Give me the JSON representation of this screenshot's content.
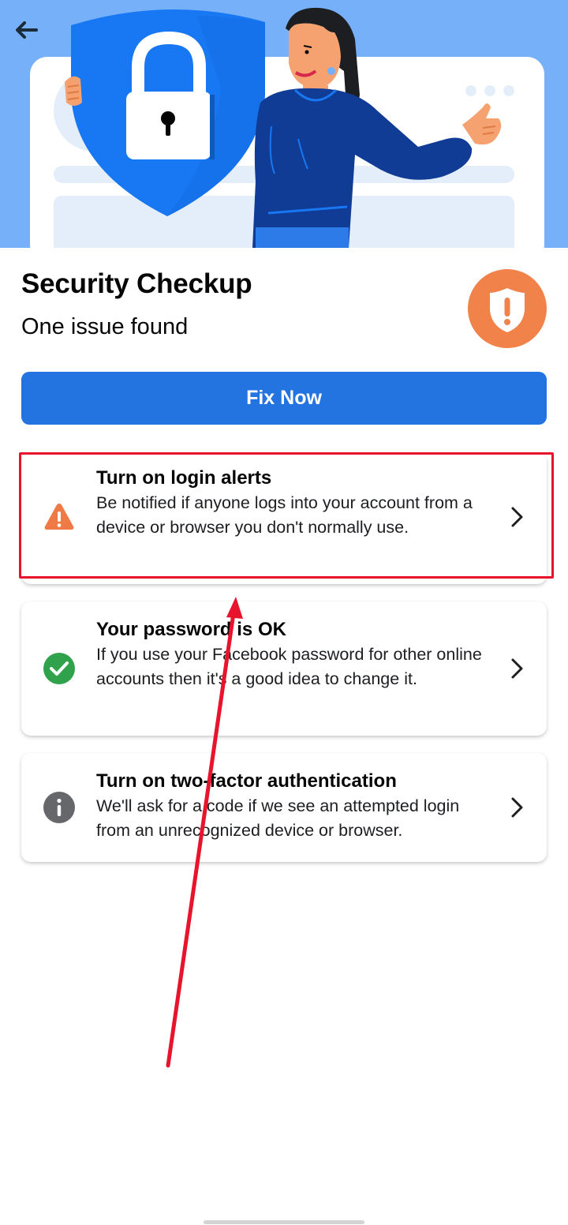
{
  "header": {
    "title": "Security Checkup",
    "subtitle": "One issue found"
  },
  "primary_action": {
    "label": "Fix Now"
  },
  "checks": [
    {
      "title": "Turn on login alerts",
      "description": "Be notified if anyone logs into your account from a device or browser you don't normally use.",
      "status_icon": "warning-icon",
      "status_color": "#f07a45"
    },
    {
      "title": "Your password is OK",
      "description": "If you use your Facebook password for other online accounts then it's a good idea to change it.",
      "status_icon": "check-circle-icon",
      "status_color": "#31a24c"
    },
    {
      "title": "Turn on two-factor authentication",
      "description": "We'll ask for a code if we see an attempted login from an unrecognized device or browser.",
      "status_icon": "info-icon",
      "status_color": "#65676b"
    }
  ],
  "colors": {
    "accent": "#2374e1",
    "hero_background": "#75b0f9",
    "annotation_red": "#e8142d"
  },
  "icons": {
    "back": "arrow-left-icon",
    "badge": "shield-alert-icon",
    "chevron": "chevron-right-icon"
  }
}
